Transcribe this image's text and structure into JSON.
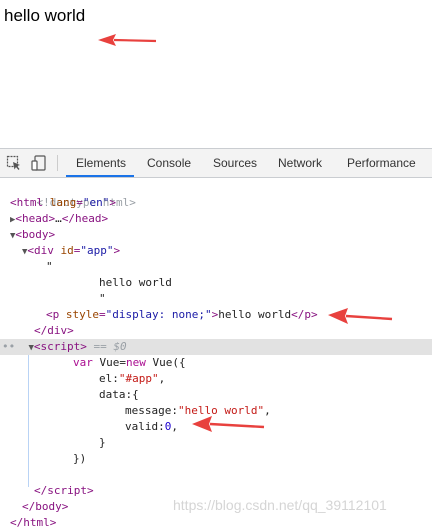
{
  "page": {
    "text": "hello world"
  },
  "devtools": {
    "tabs": [
      {
        "label": "Elements",
        "active": true
      },
      {
        "label": "Console",
        "active": false
      },
      {
        "label": "Sources",
        "active": false
      },
      {
        "label": "Network",
        "active": false
      },
      {
        "label": "Performance",
        "active": false
      }
    ],
    "source": {
      "doctype": "<!doctype html>",
      "html_open_tag": "html",
      "html_attr": "lang",
      "html_attr_val": "\"en\"",
      "head": "head",
      "head_ellipsis": "…",
      "body": "body",
      "div_tag": "div",
      "div_attr": "id",
      "div_attr_val": "\"app\"",
      "quote1": "\"",
      "text_hello": "hello world",
      "quote2": "\"",
      "p_tag": "p",
      "p_attr": "style",
      "p_attr_val": "\"display: none;\"",
      "p_text": "hello world",
      "div_close": "/div",
      "script_tag": "script",
      "script_eq": " == $0",
      "js1_kw1": "var",
      "js1_rest1": " Vue=",
      "js1_kw2": "new",
      "js1_rest2": " Vue({",
      "js2_key": "el:",
      "js2_str": "\"#app\"",
      "js2_tail": ",",
      "js3": "data:{",
      "js4_key": "message:",
      "js4_str": "\"hello world\"",
      "js4_tail": ",",
      "js5_key": "valid:",
      "js5_num": "0",
      "js5_tail": ",",
      "js6": "}",
      "js7": "})",
      "script_close": "/script",
      "body_close": "/body",
      "html_close": "/html"
    }
  },
  "watermark": "https://blog.csdn.net/qq_39112101",
  "colors": {
    "arrow": "#e8413e",
    "tab_accent": "#1a73e8"
  },
  "icons": [
    "inspect-icon",
    "device-toggle-icon"
  ]
}
